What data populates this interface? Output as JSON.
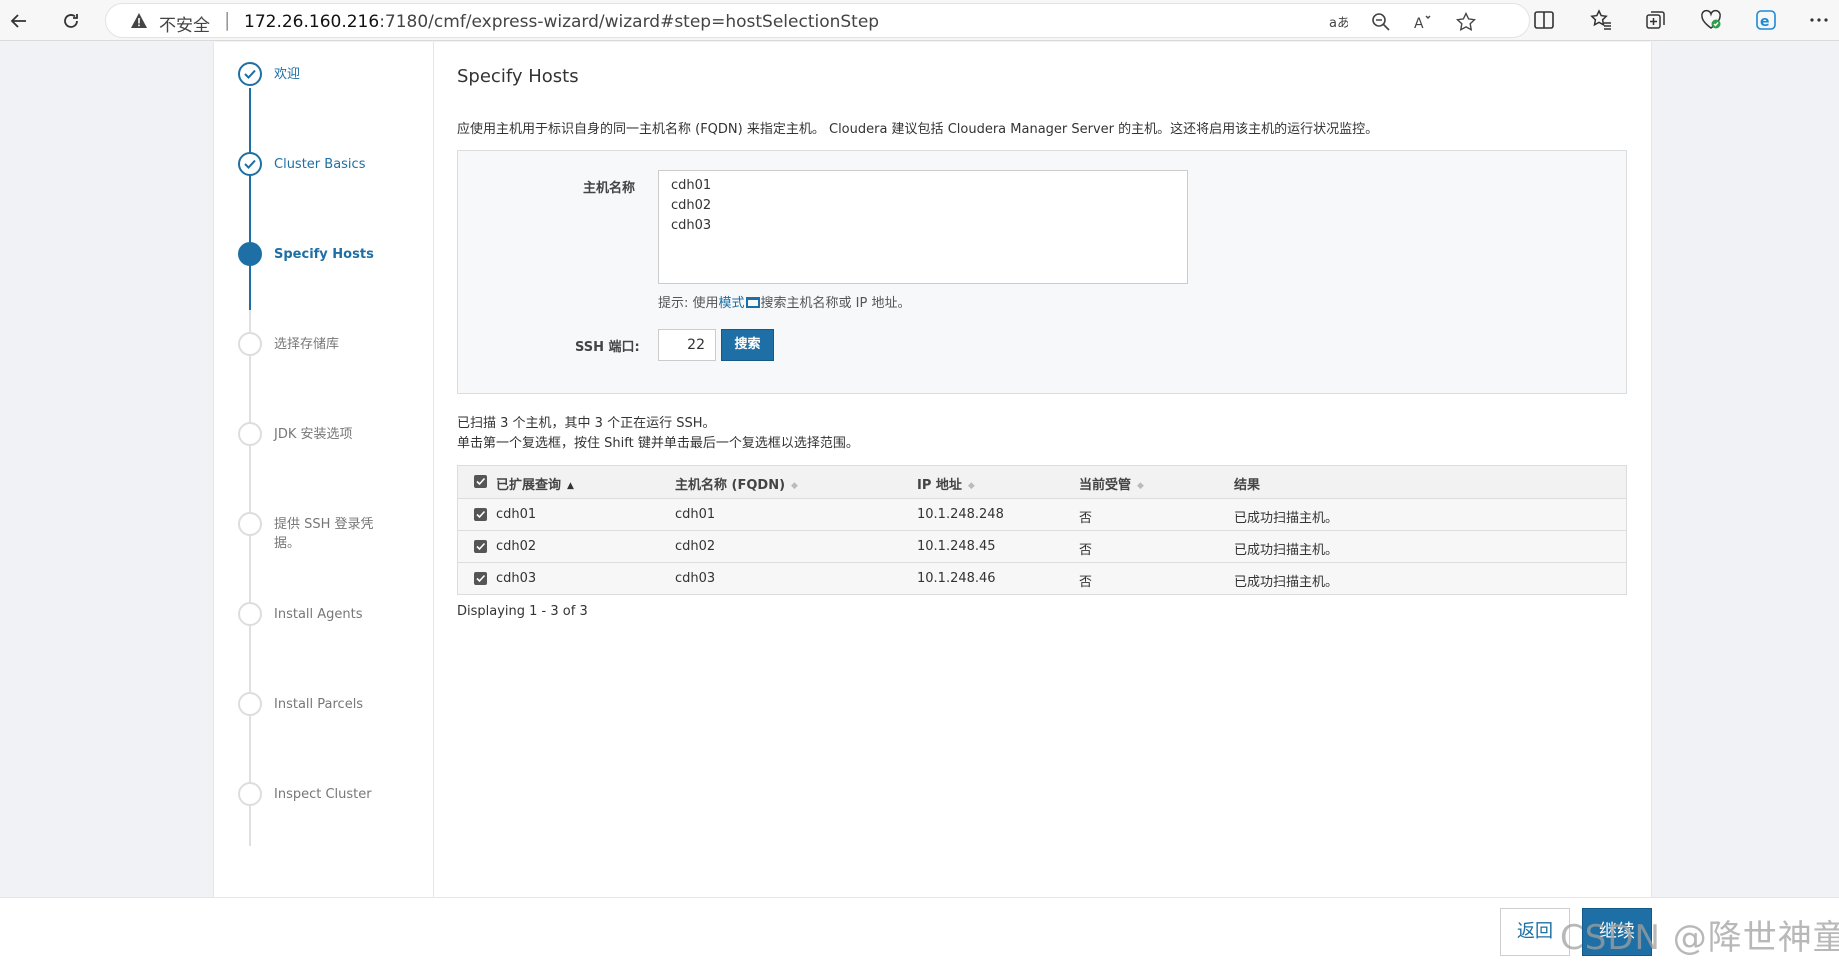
{
  "browser": {
    "insecure_label": "不安全",
    "separator": "|",
    "url_host": "172.26.160.216",
    "url_path": ":7180/cmf/express-wizard/wizard#step=hostSelectionStep"
  },
  "steps": [
    {
      "label": "欢迎",
      "state": "done"
    },
    {
      "label": "Cluster Basics",
      "state": "done"
    },
    {
      "label": "Specify Hosts",
      "state": "active"
    },
    {
      "label": "选择存储库",
      "state": "pending"
    },
    {
      "label": "JDK 安装选项",
      "state": "pending"
    },
    {
      "label": "提供 SSH 登录凭据。",
      "state": "pending"
    },
    {
      "label": "Install Agents",
      "state": "pending"
    },
    {
      "label": "Install Parcels",
      "state": "pending"
    },
    {
      "label": "Inspect Cluster",
      "state": "pending"
    }
  ],
  "main": {
    "title": "Specify Hosts",
    "description": "应使用主机用于标识自身的同一主机名称 (FQDN) 来指定主机。 Cloudera 建议包括 Cloudera Manager Server 的主机。这还将启用该主机的运行状况监控。",
    "form": {
      "host_label": "主机名称",
      "host_value": "cdh01\ncdh02\ncdh03",
      "hint_prefix": "提示: 使用",
      "hint_link": "模式",
      "hint_suffix": "搜索主机名称或 IP 地址。",
      "ssh_label": "SSH 端口:",
      "ssh_value": "22",
      "search_button": "搜索"
    },
    "scan_line1": "已扫描 3 个主机，其中 3 个正在运行 SSH。",
    "scan_line2": "单击第一个复选框，按住 Shift 键并单击最后一个复选框以选择范围。",
    "table": {
      "headers": [
        "已扩展查询",
        "主机名称 (FQDN)",
        "IP 地址",
        "当前受管",
        "结果"
      ],
      "rows": [
        {
          "expanded": "cdh01",
          "fqdn": "cdh01",
          "ip": "10.1.248.248",
          "managed": "否",
          "result": "已成功扫描主机。"
        },
        {
          "expanded": "cdh02",
          "fqdn": "cdh02",
          "ip": "10.1.248.45",
          "managed": "否",
          "result": "已成功扫描主机。"
        },
        {
          "expanded": "cdh03",
          "fqdn": "cdh03",
          "ip": "10.1.248.46",
          "managed": "否",
          "result": "已成功扫描主机。"
        }
      ]
    },
    "paging": "Displaying 1 - 3 of 3"
  },
  "footer": {
    "back_button": "返回",
    "next_button": "继续",
    "watermark": "CSDN @降世神童"
  },
  "colors": {
    "accent": "#1d6fa5"
  }
}
